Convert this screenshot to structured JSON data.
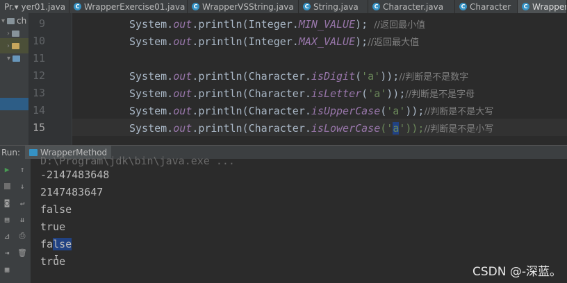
{
  "tabs": [
    {
      "label": "Pr.▾ yer01.java",
      "active": false
    },
    {
      "label": "WrapperExercise01.java",
      "active": false
    },
    {
      "label": "WrapperVSString.java",
      "active": false
    },
    {
      "label": "String.java",
      "active": false
    },
    {
      "label": "Character.java",
      "active": false
    },
    {
      "label": "Character",
      "active": false
    },
    {
      "label": "Wrapper",
      "active": true
    }
  ],
  "project_tree": {
    "items": [
      {
        "label": "ch"
      },
      {
        "label": ""
      },
      {
        "label": ""
      },
      {
        "label": ""
      }
    ]
  },
  "editor": {
    "line_numbers": [
      "9",
      "10",
      "11",
      "12",
      "13",
      "14",
      "15"
    ],
    "lines": [
      {
        "prefix": "System.",
        "field": "out",
        "mid": ".println(Integer.",
        "const": "MIN_VALUE",
        "end": "); ",
        "comment": "//返回最小值"
      },
      {
        "prefix": "System.",
        "field": "out",
        "mid": ".println(Integer.",
        "const": "MAX_VALUE",
        "end": ");",
        "comment": "//返回最大值"
      },
      {
        "prefix": "",
        "field": "",
        "mid": "",
        "const": "",
        "end": "",
        "comment": ""
      },
      {
        "prefix": "System.",
        "field": "out",
        "mid": ".println(Character.",
        "method": "isDigit",
        "open": "(",
        "str": "'a'",
        "close": "));",
        "comment": "//判断是不是数字"
      },
      {
        "prefix": "System.",
        "field": "out",
        "mid": ".println(Character.",
        "method": "isLetter",
        "open": "(",
        "str": "'a'",
        "close": "));",
        "comment": "//判断是不是字母"
      },
      {
        "prefix": "System.",
        "field": "out",
        "mid": ".println(Character.",
        "method": "isUpperCase",
        "open": "(",
        "str": "'a'",
        "close": "));",
        "comment": "//判断是不是大写"
      },
      {
        "prefix": "System.",
        "field": "out",
        "mid": ".println(Character.",
        "method": "isLowerCase",
        "open": "('",
        "str": "a",
        "close": "'));",
        "comment": "//判断是不是小写"
      }
    ]
  },
  "run_panel": {
    "label": "Run:",
    "tab_label": "WrapperMethod"
  },
  "console": {
    "lines": [
      "-2147483648",
      "2147483647",
      "false",
      "true",
      "false",
      "true"
    ]
  },
  "watermark": "CSDN @-深蓝。",
  "colors": {
    "background": "#2b2b2b",
    "selection": "#214283",
    "keyword_field": "#9876aa",
    "string": "#6a8759",
    "comment": "#808080"
  }
}
